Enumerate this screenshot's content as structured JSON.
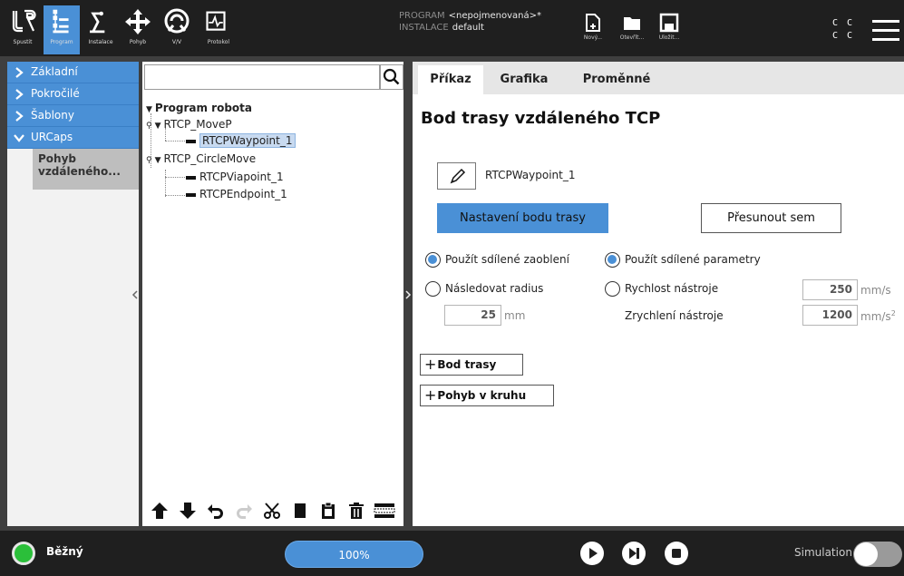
{
  "nav": [
    {
      "label": "Spustit",
      "icon": "ur-logo-icon"
    },
    {
      "label": "Program",
      "icon": "program-icon",
      "active": true
    },
    {
      "label": "Instalace",
      "icon": "installation-icon"
    },
    {
      "label": "Pohyb",
      "icon": "move-icon"
    },
    {
      "label": "V/V",
      "icon": "io-icon"
    },
    {
      "label": "Protokol",
      "icon": "log-icon"
    }
  ],
  "program_info": {
    "program_label": "PROGRAM",
    "program_value": "<nepojmenovaná>*",
    "install_label": "INSTALACE",
    "install_value": "default"
  },
  "file_buttons": [
    {
      "label": "Nový...",
      "icon": "new-file-icon"
    },
    {
      "label": "Otevřít...",
      "icon": "open-folder-icon"
    },
    {
      "label": "Uložit...",
      "icon": "save-icon"
    }
  ],
  "cc": {
    "line1": "C C",
    "line2": "C C"
  },
  "sidebar": {
    "items": [
      {
        "label": "Základní",
        "expanded": false
      },
      {
        "label": "Pokročilé",
        "expanded": false
      },
      {
        "label": "Šablony",
        "expanded": false
      },
      {
        "label": "URCaps",
        "expanded": true
      }
    ],
    "sub_item": {
      "line1": "Pohyb",
      "line2": "vzdáleného..."
    }
  },
  "tree": {
    "search_value": "",
    "rows": [
      {
        "text": "Program robota",
        "kind": "root"
      },
      {
        "text": "RTCP_MoveP",
        "kind": "group"
      },
      {
        "text": "RTCPWaypoint_1",
        "kind": "leaf",
        "selected": true
      },
      {
        "text": "RTCP_CircleMove",
        "kind": "group"
      },
      {
        "text": "RTCPViapoint_1",
        "kind": "leaf"
      },
      {
        "text": "RTCPEndpoint_1",
        "kind": "leaf"
      }
    ],
    "toolbar": [
      "move-up-icon",
      "move-down-icon",
      "undo-icon",
      "redo-icon",
      "cut-icon",
      "copy-icon",
      "paste-icon",
      "delete-icon",
      "suppress-icon"
    ]
  },
  "tabs": [
    {
      "label": "Příkaz",
      "active": true
    },
    {
      "label": "Grafika"
    },
    {
      "label": "Proměnné"
    }
  ],
  "command": {
    "title": "Bod trasy vzdáleného TCP",
    "waypoint_name": "RTCPWaypoint_1",
    "set_button": "Nastavení bodu trasy",
    "move_button": "Přesunout sem",
    "blend_shared": "Použít sdílené zaoblení",
    "blend_radius": "Následovat radius",
    "radius_value": "25",
    "radius_unit": "mm",
    "params_shared": "Použít sdílené parametry",
    "tool_speed": "Rychlost nástroje",
    "speed_value": "250",
    "speed_unit": "mm/s",
    "tool_accel": "Zrychlení nástroje",
    "accel_value": "1200",
    "accel_unit": "mm/s",
    "accel_unit_sup": "2",
    "add_waypoint": "Bod trasy",
    "add_circle": "Pohyb v kruhu"
  },
  "footer": {
    "status": "Běžný",
    "status_color": "#2bbf3a",
    "speed": "100%",
    "simulation_label": "Simulation",
    "simulation_on": false
  },
  "colors": {
    "accent": "#4a90d6",
    "header": "#1f1f1f"
  }
}
